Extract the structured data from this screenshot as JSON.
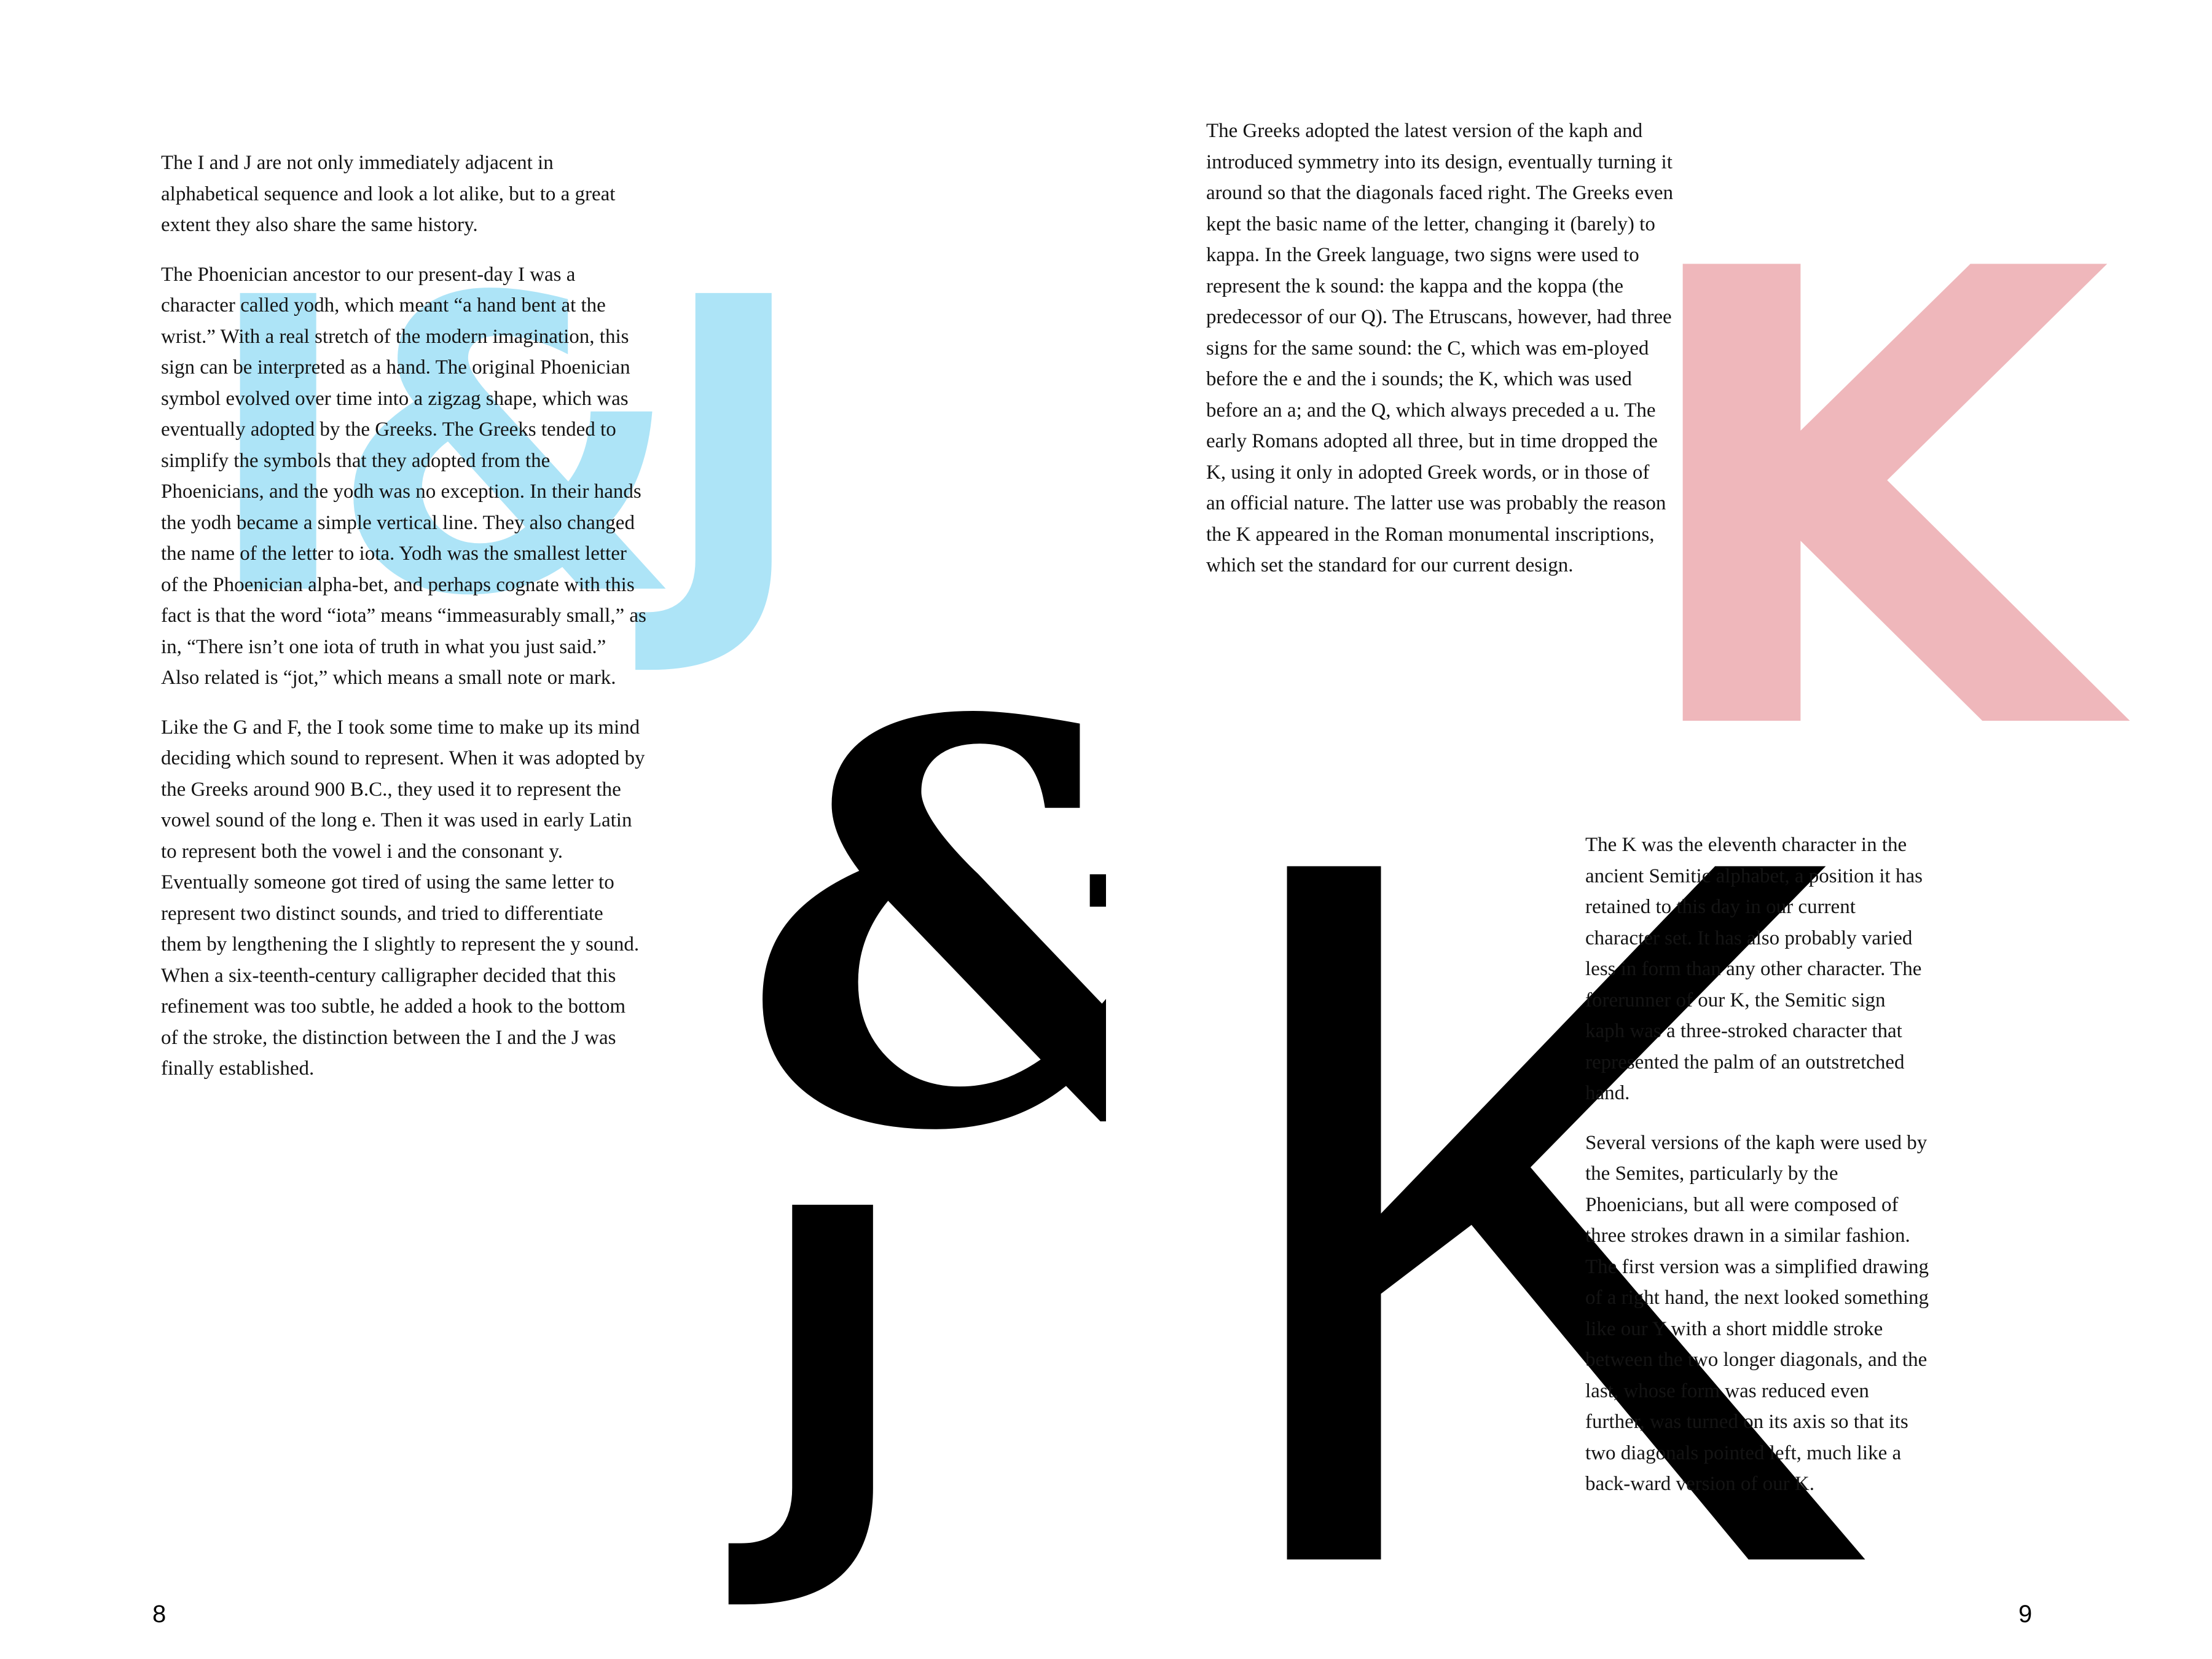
{
  "left_page": {
    "display": {
      "ij": "I&J",
      "amp": "&",
      "j": "J"
    },
    "paragraphs": [
      "The I and J are not only immediately adjacent in alphabetical sequence and look a lot alike, but to a great extent they also share the same history.",
      "The Phoenician ancestor to our present-day I was a character called yodh, which meant “a hand bent at the wrist.” With a real stretch of the modern imagination, this sign can be interpreted as a hand. The original Phoenician symbol evolved over time into a zigzag shape, which was eventually adopted by the Greeks. The Greeks tended to simplify the symbols that they adopted from the Phoenicians, and the yodh was no exception. In their hands the yodh became a simple vertical line. They also changed the name of the letter to iota. Yodh was the smallest letter of the Phoenician alpha-bet, and perhaps cognate with this fact is that the word “iota” means “immeasurably small,” as in, “There isn’t one iota of truth in what you just said.” Also related is “jot,” which means a small note or mark.",
      "Like the G and F, the I took some time to make up its mind deciding which sound to represent. When it was adopted by the Greeks around 900 B.C., they used it to represent the vowel sound of the long e. Then it was used in early Latin to represent both the vowel i and the consonant y. Eventually someone got tired of using the same letter to represent two distinct sounds, and tried to differentiate them by lengthening the I slightly to represent the y sound. When a six-teenth-century calligrapher decided that this refinement was too subtle, he added a hook to the bottom of the stroke, the distinction between the I and the J was finally established."
    ],
    "page_number": "8"
  },
  "right_page": {
    "display": {
      "k_pink": "K",
      "k_black": "K"
    },
    "greeks_paragraph": "The Greeks adopted the latest version of the kaph and introduced symmetry into its design, eventually turning it around so that the diagonals faced right. The Greeks even kept the basic name of the letter, changing it (barely) to kappa. In the Greek language, two signs were used to represent the k sound: the kappa and the koppa (the predecessor of our Q). The Etruscans, however, had three signs for the same sound: the C, which was em-ployed before the e and the i sounds; the K, which was used before an a; and the Q, which always preceded a u. The early Romans adopted all three, but in time dropped the K, using it only in adopted Greek words, or in those of an official nature. The latter use was probably the reason the K appeared in the Roman monumental inscriptions, which set the standard for our current design.",
    "kaph_paragraphs": [
      "The K was the eleventh character in the ancient Semitic alphabet, a position it has retained to this day in our current character set. It has also probably varied less in form than any other character. The forerunner of our K, the Semitic sign kaph was a three-stroked character that represented the palm of an outstretched hand.",
      "Several versions of the kaph were used by the Semites, particularly by the Phoenicians, but all were composed of three strokes drawn in a similar fashion. The first version was a simplified drawing of a right hand, the next looked something like our Y with a short middle stroke between the two longer diagonals, and the last, whose form was reduced even further, was turned on its axis so that its two diagonals pointed left, much like a back-ward version of our K."
    ],
    "page_number": "9"
  },
  "colors": {
    "ij_tint": "#ade4f7",
    "k_tint": "#efb7bb",
    "ink": "#000000"
  }
}
